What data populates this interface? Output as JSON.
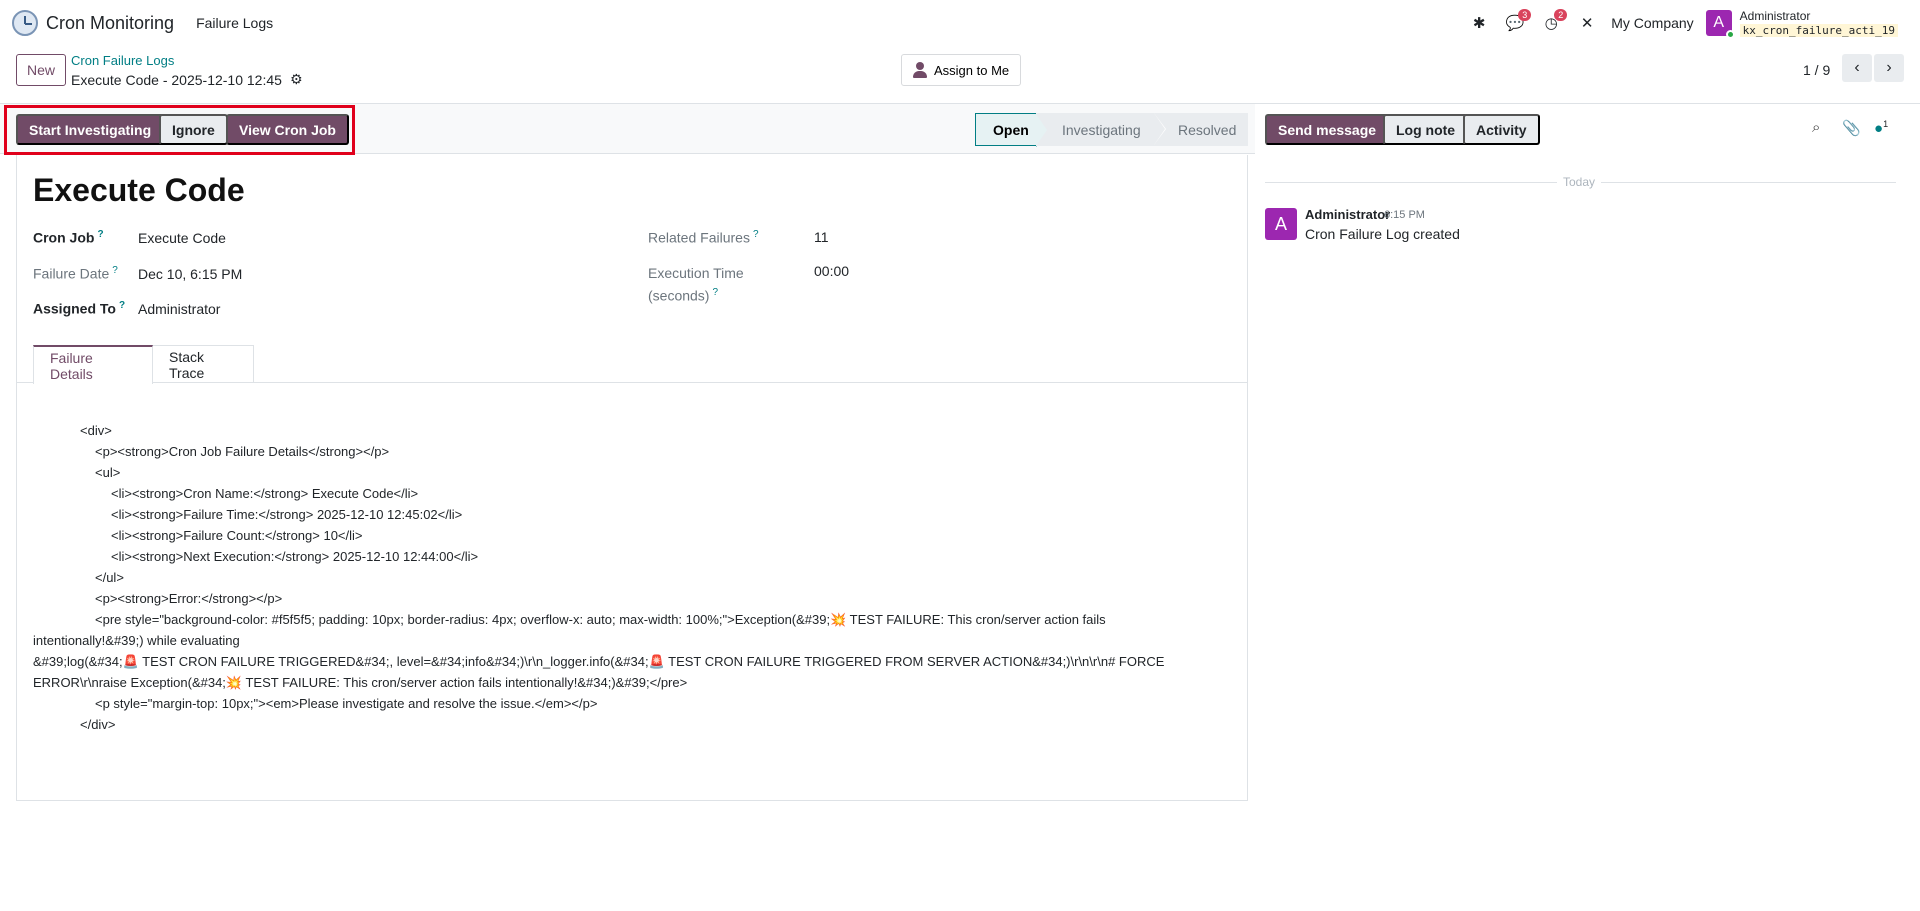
{
  "navbar": {
    "app_name": "Cron Monitoring",
    "menu_item": "Failure Logs",
    "messages_count": "3",
    "activities_count": "2",
    "company": "My Company",
    "user_initial": "A",
    "user_name": "Administrator",
    "database": "kx_cron_failure_acti_19",
    "icons": [
      "bug-icon",
      "chat-icon",
      "clock-icon",
      "tools-icon"
    ]
  },
  "control_panel": {
    "new_label": "New",
    "breadcrumb_parent": "Cron Failure Logs",
    "record_name": "Execute Code - 2025-12-10 12:45",
    "assign_label": "Assign to Me",
    "pager": "1 / 9"
  },
  "statusbar": {
    "start_label": "Start Investigating",
    "ignore_label": "Ignore",
    "view_cron_label": "View Cron Job",
    "stages": [
      "Open",
      "Investigating",
      "Resolved"
    ],
    "current_stage": "Open"
  },
  "form": {
    "title": "Execute Code",
    "cron_job_label": "Cron Job",
    "cron_job_value": "Execute Code",
    "failure_date_label": "Failure Date",
    "failure_date_value": "Dec 10, 6:15 PM",
    "assigned_to_label": "Assigned To",
    "assigned_to_value": "Administrator",
    "related_failures_label": "Related Failures",
    "related_failures_value": "11",
    "execution_time_label_1": "Execution Time",
    "execution_time_label_2": "(seconds)",
    "execution_time_value": "00:00",
    "tabs": [
      "Failure Details",
      "Stack Trace"
    ],
    "details_lines": [
      "<div>",
      "<p><strong>Cron Job Failure Details</strong></p>",
      "<ul>",
      "<li><strong>Cron Name:</strong> Execute Code</li>",
      "<li><strong>Failure Time:</strong> 2025-12-10 12:45:02</li>",
      "<li><strong>Failure Count:</strong> 10</li>",
      "<li><strong>Next Execution:</strong> 2025-12-10 12:44:00</li>",
      "</ul>",
      "<p><strong>Error:</strong></p>",
      "<pre style=\"background-color: #f5f5f5; padding: 10px; border-radius: 4px; overflow-x: auto; max-width: 100%;\">Exception(&#39;💥 TEST FAILURE: This cron/server action fails",
      "intentionally!&#39;) while evaluating",
      "&#39;log(&#34;🚨 TEST CRON FAILURE TRIGGERED&#34;, level=&#34;info&#34;)\\r\\n_logger.info(&#34;🚨 TEST CRON FAILURE TRIGGERED FROM SERVER ACTION&#34;)\\r\\n\\r\\n# FORCE",
      "ERROR\\r\\nraise Exception(&#34;💥 TEST FAILURE: This cron/server action fails intentionally!&#34;)&#39;</pre>",
      "<p style=\"margin-top: 10px;\"><em>Please investigate and resolve the issue.</em></p>",
      "</div>"
    ]
  },
  "chatter": {
    "send_message_label": "Send message",
    "log_note_label": "Log note",
    "activity_label": "Activity",
    "followers_count": "1",
    "today_label": "Today",
    "message": {
      "author_initial": "A",
      "author": "Administrator",
      "time": "6:15 PM",
      "body": "Cron Failure Log created"
    }
  },
  "colors": {
    "brand": "#714b67",
    "accent_teal": "#017e84",
    "highlight_red": "#e0001b",
    "badge_red": "#d9435c",
    "avatar_purple": "#9c27b0"
  }
}
